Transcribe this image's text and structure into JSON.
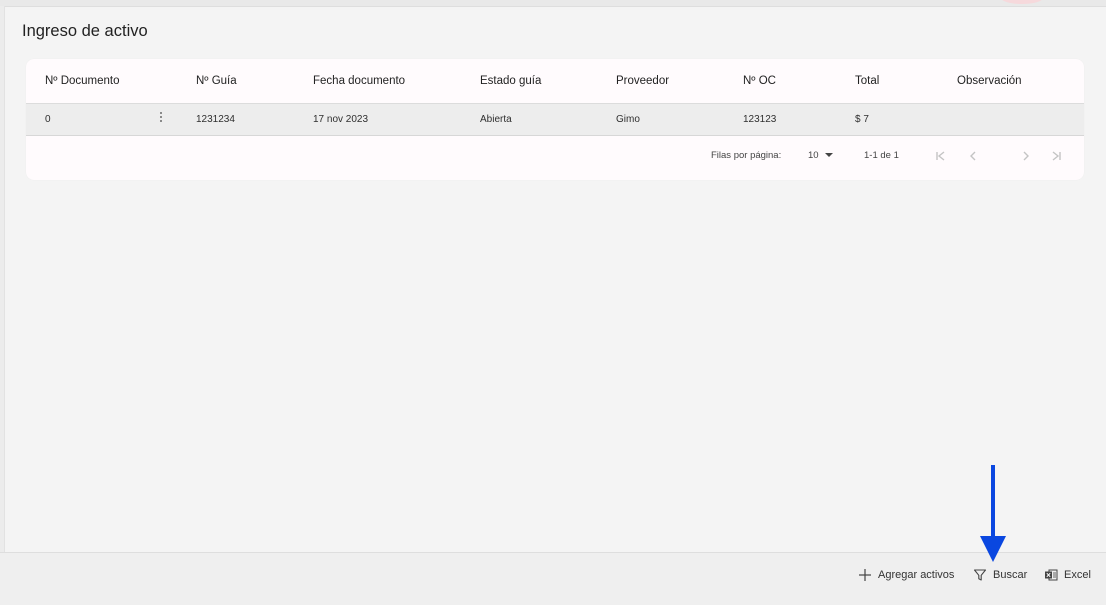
{
  "page": {
    "title": "Ingreso de activo"
  },
  "table": {
    "columns": [
      "Nº Documento",
      "Nº Guía",
      "Fecha documento",
      "Estado guía",
      "Proveedor",
      "Nº OC",
      "Total",
      "Observación"
    ],
    "rows": [
      {
        "documento": "0",
        "guia": "1231234",
        "fecha": "17 nov 2023",
        "estado": "Abierta",
        "proveedor": "Gimo",
        "oc": "123123",
        "total": "$ 7",
        "observacion": ""
      }
    ]
  },
  "pagination": {
    "rows_per_page_label": "Filas por página:",
    "rows_per_page_value": "10",
    "range_text": "1-1 de 1"
  },
  "actions": {
    "add_label": "Agregar activos",
    "search_label": "Buscar",
    "excel_label": "Excel"
  },
  "annotation": {
    "arrow_color": "#0a47e0"
  },
  "icons": [
    "more-vert-icon",
    "first-page-icon",
    "chevron-left-icon",
    "chevron-right-icon",
    "last-page-icon",
    "plus-icon",
    "filter-icon",
    "excel-icon",
    "arrow-down-icon"
  ]
}
